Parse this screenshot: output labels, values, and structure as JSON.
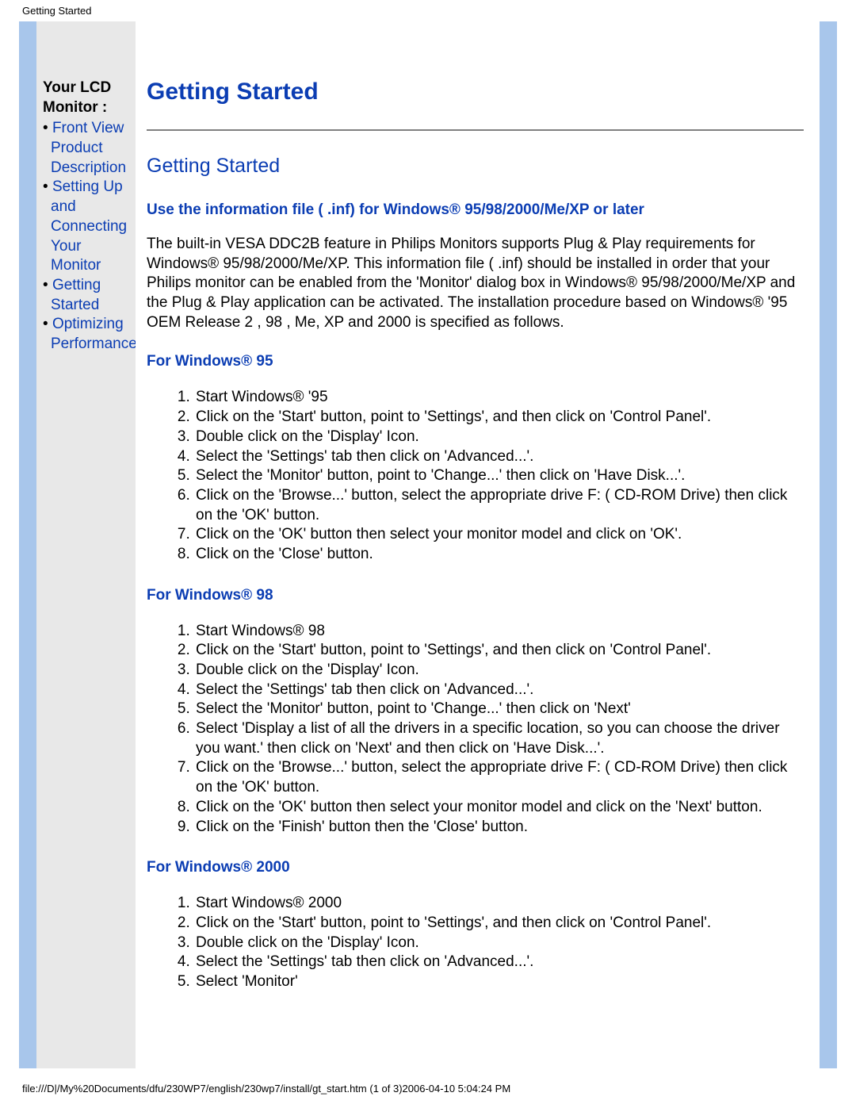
{
  "header": "Getting Started",
  "sidebar": {
    "title": "Your LCD Monitor :",
    "items": [
      "Front View Product Description",
      "Setting Up and Connecting Your Monitor",
      "Getting Started",
      "Optimizing Performance"
    ]
  },
  "content": {
    "mainHeading": "Getting Started",
    "subHeading": "Getting Started",
    "infHeading": "Use the information file ( .inf) for Windows® 95/98/2000/Me/XP or later",
    "intro": "The built-in VESA DDC2B feature in Philips Monitors supports Plug & Play requirements for Windows® 95/98/2000/Me/XP. This information file ( .inf) should be installed in order that your Philips monitor can be enabled from the 'Monitor' dialog box in Windows® 95/98/2000/Me/XP and the Plug & Play application can be activated. The installation procedure based on Windows® '95 OEM Release 2 , 98 , Me, XP and 2000 is specified as follows.",
    "win95Title": "For Windows® 95",
    "win95Steps": [
      "Start Windows® '95",
      "Click on the 'Start' button, point to 'Settings', and then click on 'Control Panel'.",
      "Double click on the 'Display' Icon.",
      "Select the 'Settings' tab then click on 'Advanced...'.",
      "Select the 'Monitor' button, point to 'Change...' then click on 'Have Disk...'.",
      "Click on the 'Browse...' button, select the appropriate drive F: ( CD-ROM Drive) then click on the 'OK' button.",
      "Click on the 'OK' button then select your monitor model and click on 'OK'.",
      "Click on the 'Close' button."
    ],
    "win98Title": "For Windows® 98",
    "win98Steps": [
      "Start Windows® 98",
      "Click on the 'Start' button, point to 'Settings', and then click on 'Control Panel'.",
      "Double click on the 'Display' Icon.",
      "Select the 'Settings' tab then click on 'Advanced...'.",
      "Select the 'Monitor' button, point to 'Change...' then click on 'Next'",
      "Select 'Display a list of all the drivers in a specific location, so you can choose the driver you want.' then click on 'Next' and then click on 'Have Disk...'.",
      "Click on the 'Browse...' button, select the appropriate drive F: ( CD-ROM Drive) then click on the 'OK' button.",
      "Click on the 'OK' button then select your monitor model and click on the 'Next' button.",
      "Click on the 'Finish' button then the 'Close' button."
    ],
    "win2kTitle": "For Windows® 2000",
    "win2kSteps": [
      "Start Windows® 2000",
      "Click on the 'Start' button, point to 'Settings', and then click on 'Control Panel'.",
      "Double click on the 'Display' Icon.",
      "Select the 'Settings' tab then click on 'Advanced...'.",
      "Select 'Monitor'"
    ]
  },
  "footer": "file:///D|/My%20Documents/dfu/230WP7/english/230wp7/install/gt_start.htm (1 of 3)2006-04-10 5:04:24 PM"
}
